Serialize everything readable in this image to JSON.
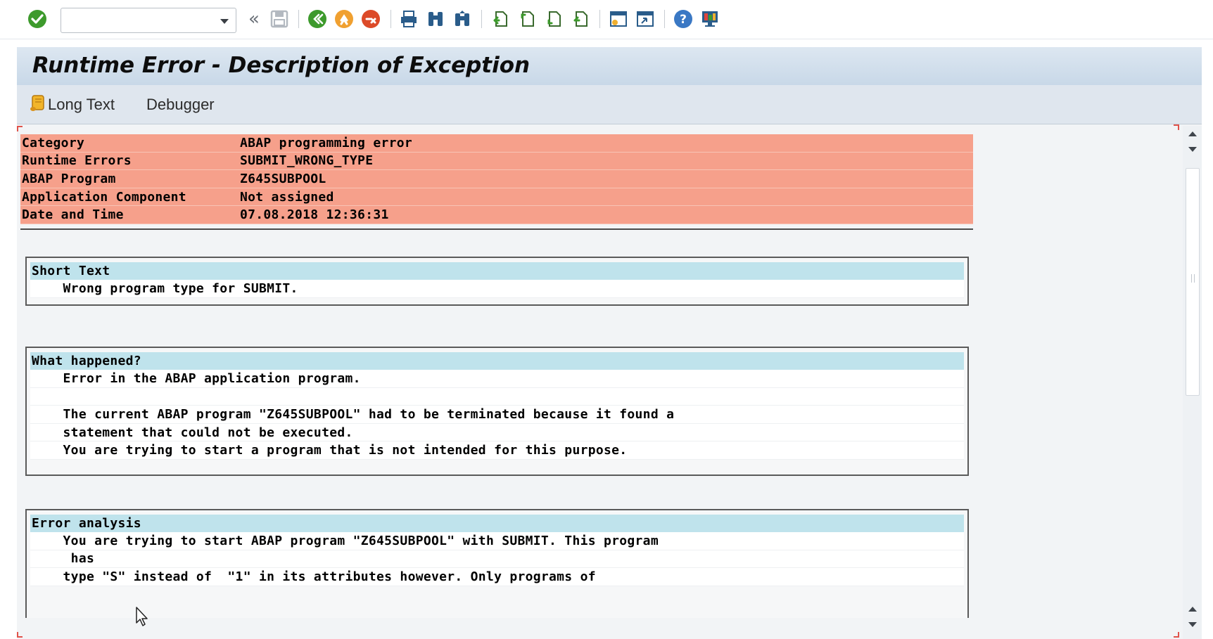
{
  "toolbar": {
    "command_field_value": "",
    "icons": [
      "enter-icon",
      "back-double-icon",
      "save-icon",
      "back-icon",
      "exit-icon",
      "cancel-icon",
      "print-icon",
      "find-icon",
      "find-next-icon",
      "first-page-icon",
      "previous-page-icon",
      "next-page-icon",
      "last-page-icon",
      "create-session-icon",
      "generate-shortcut-icon",
      "help-icon",
      "customize-layout-icon"
    ]
  },
  "window": {
    "title": "Runtime Error - Description of Exception"
  },
  "app_toolbar": {
    "long_text_label": "Long Text",
    "debugger_label": "Debugger"
  },
  "header": {
    "rows": [
      {
        "key": "Category",
        "value": "ABAP programming error"
      },
      {
        "key": "Runtime Errors",
        "value": "SUBMIT_WRONG_TYPE"
      },
      {
        "key": "ABAP Program",
        "value": "Z645SUBPOOL"
      },
      {
        "key": "Application Component",
        "value": "Not assigned"
      },
      {
        "key": "Date and Time",
        "value": "07.08.2018 12:36:31"
      }
    ]
  },
  "sections": {
    "short_text": {
      "title": "Short Text",
      "lines": [
        "    Wrong program type for SUBMIT."
      ]
    },
    "what_happened": {
      "title": "What happened?",
      "lines": [
        "    Error in the ABAP application program.",
        "",
        "    The current ABAP program \"Z645SUBPOOL\" had to be terminated because it found a",
        "    statement that could not be executed.",
        "    You are trying to start a program that is not intended for this purpose."
      ]
    },
    "error_analysis": {
      "title": "Error analysis",
      "lines": [
        "    You are trying to start ABAP program \"Z645SUBPOOL\" with SUBMIT. This program",
        "     has",
        "    type \"S\" instead of  \"1\" in its attributes however. Only programs of"
      ]
    }
  },
  "colors": {
    "header_bg": "#f6a08b",
    "section_title_bg": "#bfe3ec",
    "title_bar_bg": "#c8d8e8",
    "toolbar_green": "#3d9a2c",
    "toolbar_orange": "#f0a030",
    "toolbar_red": "#dc4a28"
  }
}
